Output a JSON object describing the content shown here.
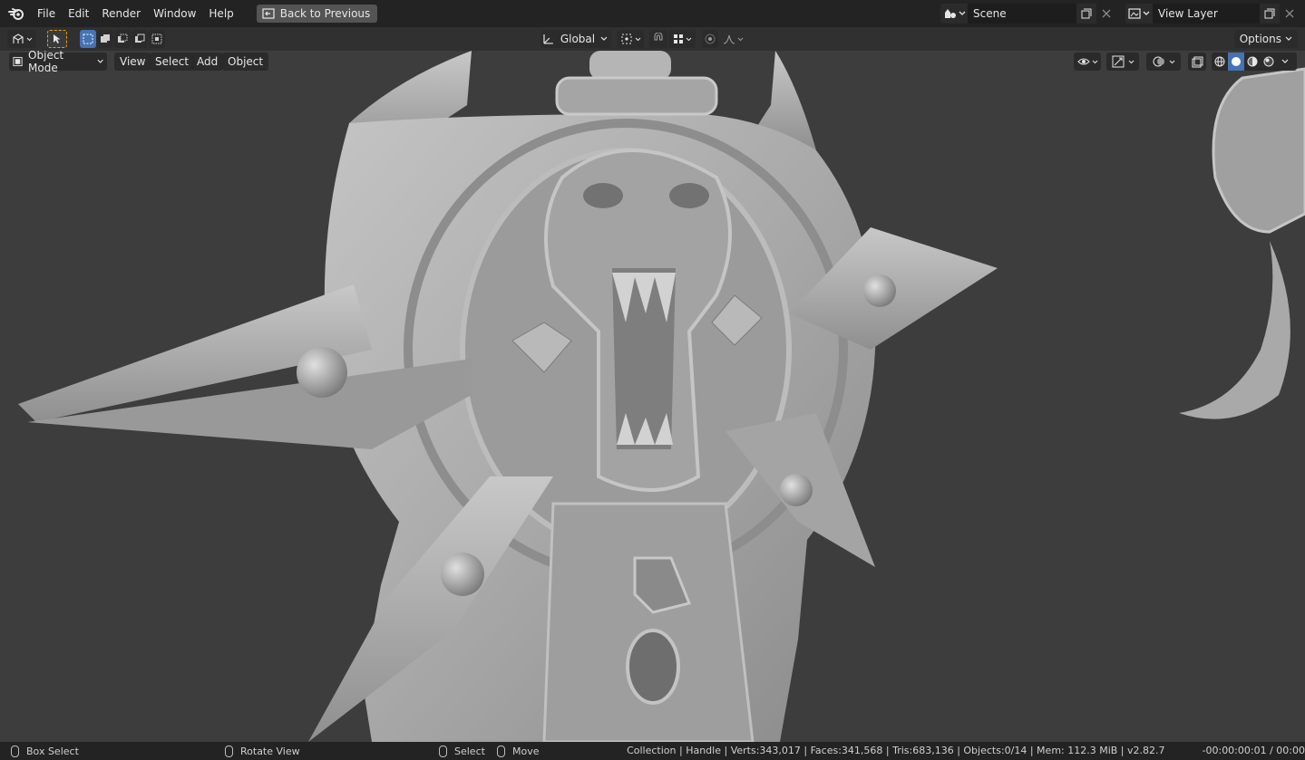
{
  "topbar": {
    "menus": [
      "File",
      "Edit",
      "Render",
      "Window",
      "Help"
    ],
    "back_label": "Back to Previous",
    "scene_value": "Scene",
    "view_layer_value": "View Layer"
  },
  "toolheader": {
    "orientation": "Global",
    "options_label": "Options"
  },
  "viewport": {
    "mode": "Object Mode",
    "menus": [
      "View",
      "Select",
      "Add",
      "Object"
    ]
  },
  "statusbar": {
    "box_select": "Box Select",
    "rotate_view": "Rotate View",
    "select": "Select",
    "move": "Move",
    "stats": "Collection | Handle | Verts:343,017 | Faces:341,568 | Tris:683,136 | Objects:0/14 | Mem: 112.3 MiB | v2.82.7",
    "time": "-00:00:00:01 / 00:00"
  },
  "colors": {
    "accent": "#4772b3",
    "background": "#3d3d3d",
    "model": "#a8a8a8"
  }
}
